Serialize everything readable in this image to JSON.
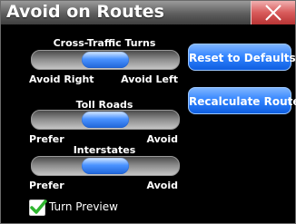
{
  "window": {
    "title": "Avoid on Routes"
  },
  "sliders": [
    {
      "label": "Cross-Traffic Turns",
      "left_label": "Avoid Right",
      "right_label": "Avoid Left",
      "value_percent": 50
    },
    {
      "label": "Toll Roads",
      "left_label": "Prefer",
      "right_label": "Avoid",
      "value_percent": 50
    },
    {
      "label": "Interstates",
      "left_label": "Prefer",
      "right_label": "Avoid",
      "value_percent": 50
    }
  ],
  "buttons": {
    "reset": "Reset to Defaults",
    "recalculate": "Recalculate Route"
  },
  "turn_preview": {
    "label": "Turn Preview",
    "checked": true
  },
  "colors": {
    "accent_blue": "#2f82ff",
    "close_red": "#d85a5a",
    "check_green": "#2fb52f",
    "background": "#000000"
  },
  "icons": {
    "close": "close-icon",
    "check": "checkmark-icon"
  }
}
